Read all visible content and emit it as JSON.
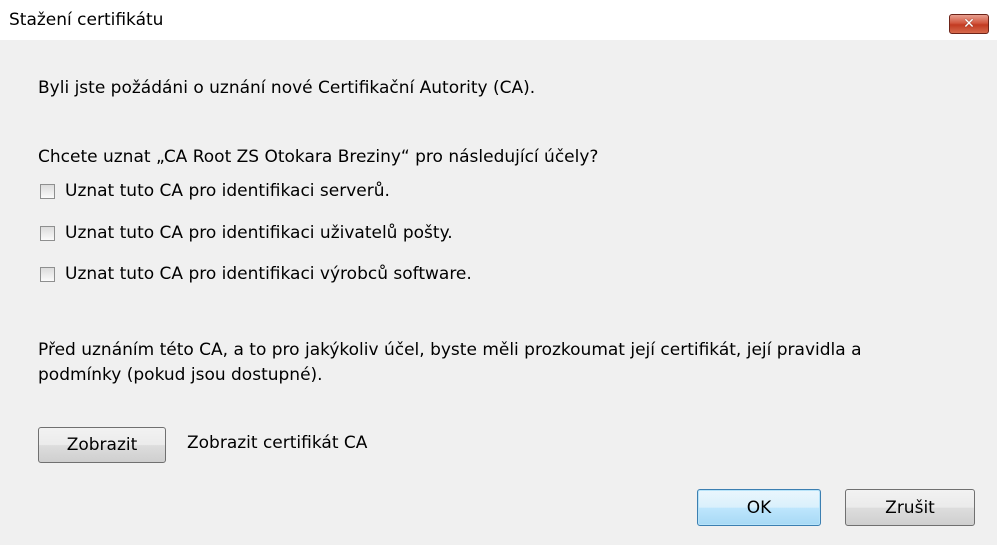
{
  "window": {
    "title": "Stažení certifikátu",
    "close_glyph": "✕"
  },
  "dialog": {
    "intro": "Byli jste požádáni o uznání nové Certifikační Autority (CA).",
    "question": "Chcete uznat „CA Root ZS Otokara Breziny“ pro následující účely?",
    "options": [
      {
        "label": "Uznat tuto CA pro identifikaci serverů.",
        "checked": false
      },
      {
        "label": "Uznat tuto CA pro identifikaci uživatelů pošty.",
        "checked": false
      },
      {
        "label": "Uznat tuto CA pro identifikaci výrobců software.",
        "checked": false
      }
    ],
    "note_line1": "Před uznáním této CA, a to pro jakýkoliv účel, byste měli prozkoumat její certifikát, její pravidla a",
    "note_line2": "podmínky (pokud jsou dostupné).",
    "view_button_label": "Zobrazit",
    "view_description": "Zobrazit certifikát CA",
    "ok_label": "OK",
    "cancel_label": "Zrušit"
  },
  "icons": {
    "close": "close-icon"
  },
  "colors": {
    "window_background": "#f0f0f0",
    "close_button": "#c23a22",
    "default_button_border": "#3c7fb1"
  }
}
